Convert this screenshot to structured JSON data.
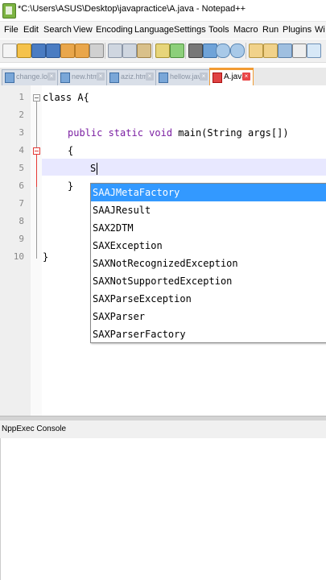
{
  "window": {
    "title": "*C:\\Users\\ASUS\\Desktop\\javapractice\\A.java - Notepad++"
  },
  "menu": {
    "items": [
      "File",
      "Edit",
      "Search",
      "View",
      "Encoding",
      "Language",
      "Settings",
      "Tools",
      "Macro",
      "Run",
      "Plugins",
      "Wi"
    ]
  },
  "toolbar": {
    "icons": [
      "new-icon",
      "open-icon",
      "save-icon",
      "save-all-icon",
      "close-icon",
      "close-all-icon",
      "print-icon",
      "cut-icon",
      "copy-icon",
      "paste-icon",
      "undo-icon",
      "redo-icon",
      "find-icon",
      "replace-icon",
      "zoom-in-icon",
      "zoom-out-icon",
      "sync-v-icon",
      "sync-h-icon",
      "wrap-icon",
      "all-chars-icon",
      "indent-guide-icon"
    ]
  },
  "tabs": [
    {
      "label": "change.log",
      "active": false
    },
    {
      "label": "new.html",
      "active": false
    },
    {
      "label": "aziz.html",
      "active": false
    },
    {
      "label": "hellow.java",
      "active": false
    },
    {
      "label": "A.java",
      "active": true
    }
  ],
  "editor": {
    "line_numbers": [
      "1",
      "2",
      "3",
      "4",
      "5",
      "6",
      "7",
      "8",
      "9",
      "10"
    ],
    "lines": {
      "l1": "class A{",
      "l3_kw": "public static void",
      "l3_rest": " main(String args[])",
      "l4": "{",
      "l5": "S",
      "l6": "}",
      "l10": "}"
    }
  },
  "autocomplete": {
    "items": [
      "SAAJMetaFactory",
      "SAAJResult",
      "SAX2DTM",
      "SAXException",
      "SAXNotRecognizedException",
      "SAXNotSupportedException",
      "SAXParseException",
      "SAXParser",
      "SAXParserFactory"
    ],
    "selected_index": 0
  },
  "console": {
    "title": "NppExec Console"
  },
  "colors": {
    "keyword": "#7b1fa2",
    "selection": "#3399ff",
    "active_tab_accent": "#f29b33"
  }
}
